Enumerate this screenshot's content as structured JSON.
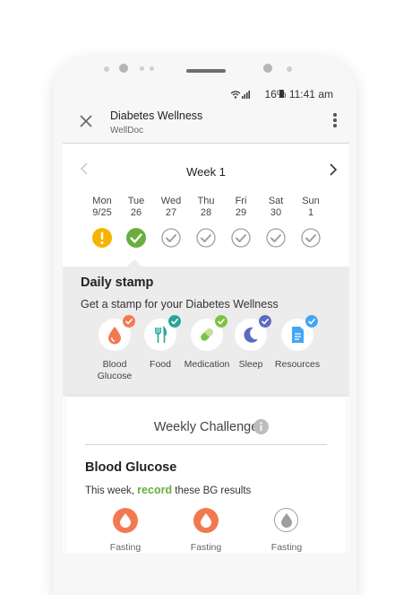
{
  "status_bar": {
    "battery": "16%",
    "time": "11:41 am"
  },
  "app_bar": {
    "title": "Diabetes Wellness",
    "subtitle": "WellDoc"
  },
  "week": {
    "label": "Week 1"
  },
  "days": [
    {
      "name": "Mon",
      "date": "9/25",
      "state": "alert"
    },
    {
      "name": "Tue",
      "date": "26",
      "state": "done"
    },
    {
      "name": "Wed",
      "date": "27",
      "state": "pending"
    },
    {
      "name": "Thu",
      "date": "28",
      "state": "pending"
    },
    {
      "name": "Fri",
      "date": "29",
      "state": "pending"
    },
    {
      "name": "Sat",
      "date": "30",
      "state": "pending"
    },
    {
      "name": "Sun",
      "date": "1",
      "state": "pending"
    }
  ],
  "daily_stamp": {
    "title": "Daily stamp",
    "subtitle": "Get a stamp for your Diabetes Wellness",
    "categories": [
      {
        "label_line1": "Blood",
        "label_line2": "Glucose",
        "icon": "blood-drop-icon",
        "color": "#f2794f"
      },
      {
        "label_line1": "Food",
        "label_line2": "",
        "icon": "fork-knife-icon",
        "color": "#26a69a"
      },
      {
        "label_line1": "Medication",
        "label_line2": "",
        "icon": "pill-icon",
        "color": "#7cc243"
      },
      {
        "label_line1": "Sleep",
        "label_line2": "",
        "icon": "moon-icon",
        "color": "#5c6bc0"
      },
      {
        "label_line1": "Resources",
        "label_line2": "",
        "icon": "document-icon",
        "color": "#42a5f5"
      }
    ]
  },
  "weekly_challenge": {
    "title": "Weekly Challenge",
    "section_title": "Blood Glucose",
    "text_before": "This week, ",
    "text_accent": "record",
    "text_after": " these BG results",
    "items": [
      {
        "label": "Fasting",
        "recorded": true
      },
      {
        "label": "Fasting",
        "recorded": true
      },
      {
        "label": "Fasting",
        "recorded": false
      }
    ]
  },
  "colors": {
    "accent_orange": "#f2794f",
    "accent_green": "#6aae3c",
    "alert_yellow": "#f5b400"
  }
}
